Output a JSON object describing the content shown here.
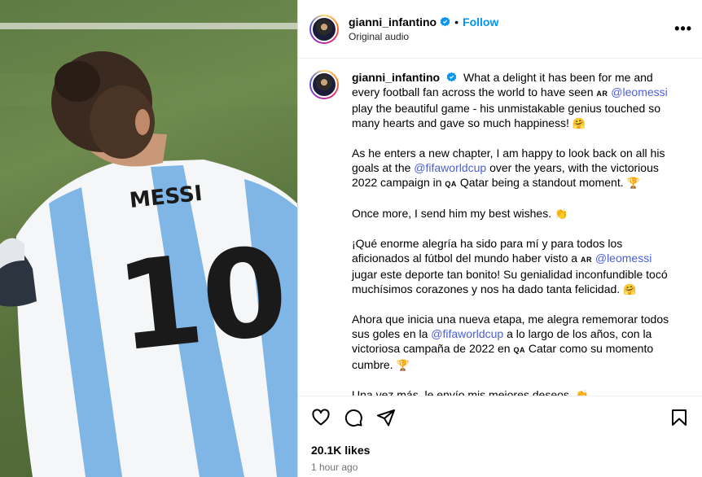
{
  "post": {
    "username": "gianni_infantino",
    "follow_label": "Follow",
    "dot": "•",
    "audio": "Original audio",
    "more": "•••"
  },
  "caption": {
    "username": "gianni_infantino",
    "p1_a": "What a delight it has been for me and every football fan across the world to have seen",
    "p1_flag": "AR",
    "p1_mention": "@leomessi",
    "p1_b": "play the beautiful game - his unmistakable genius touched so many hearts and gave so much happiness!",
    "p1_emoji": "🤗",
    "p2_a": "As he enters a new chapter, I am happy to look back on all his goals at the",
    "p2_mention": "@fifaworldcup",
    "p2_b": "over the years, with the victorious 2022 campaign in",
    "p2_flag": "QA",
    "p2_c": "Qatar being a standout moment.",
    "p2_emoji": "🏆",
    "p3": "Once more, I send him my best wishes.",
    "p3_emoji": "👏",
    "p4_a": "¡Qué enorme alegría ha sido para mí y para todos los aficionados al fútbol del mundo haber visto a",
    "p4_flag": "AR",
    "p4_mention": "@leomessi",
    "p4_b": "jugar este deporte tan bonito! Su genialidad inconfundible tocó muchísimos corazones y nos ha dado tanta felicidad.",
    "p4_emoji": "🤗",
    "p5_a": "Ahora que inicia una nueva etapa, me alegra rememorar todos sus goles en la",
    "p5_mention": "@fifaworldcup",
    "p5_b": "a lo largo de los años, con la victoriosa campaña de 2022 en",
    "p5_flag": "QA",
    "p5_c": "Catar como su momento cumbre.",
    "p5_emoji": "🏆",
    "p6": "Una vez más, le envío mis mejores deseos.",
    "p6_emoji": "👏"
  },
  "media": {
    "jersey_name": "MESSI",
    "jersey_number": "10"
  },
  "footer": {
    "likes": "20.1K likes",
    "time": "1 hour ago"
  },
  "colors": {
    "link": "#4a5fd6",
    "follow": "#0095f6",
    "jersey_blue": "#7fb6e6"
  },
  "icons": [
    "heart-icon",
    "comment-icon",
    "share-icon",
    "bookmark-icon",
    "verified-icon",
    "more-icon"
  ]
}
